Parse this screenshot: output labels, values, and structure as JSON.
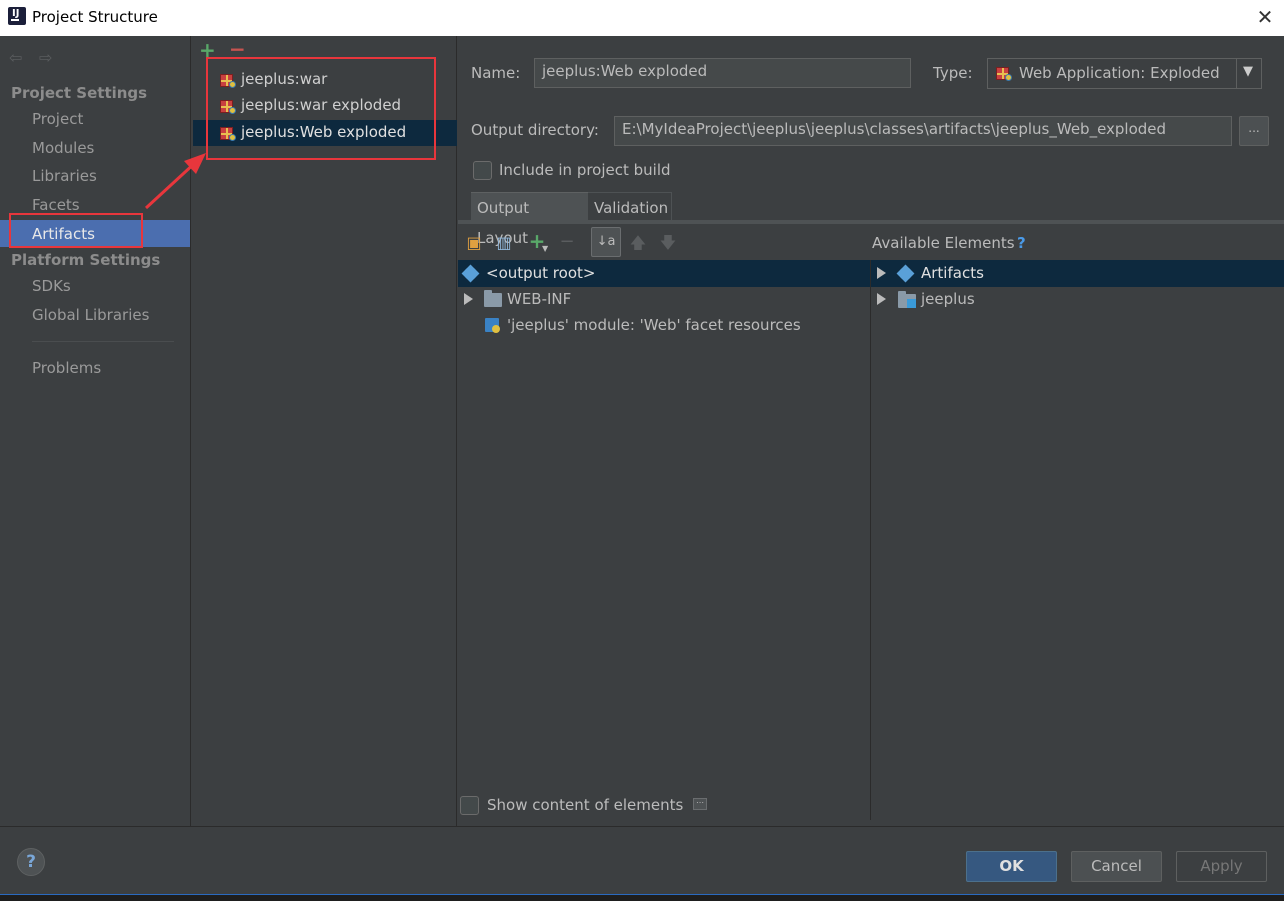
{
  "window": {
    "title": "Project Structure"
  },
  "sidebar": {
    "project_settings_header": "Project Settings",
    "project_items": [
      {
        "label": "Project"
      },
      {
        "label": "Modules"
      },
      {
        "label": "Libraries"
      },
      {
        "label": "Facets"
      },
      {
        "label": "Artifacts"
      }
    ],
    "platform_settings_header": "Platform Settings",
    "platform_items": [
      {
        "label": "SDKs"
      },
      {
        "label": "Global Libraries"
      }
    ],
    "problems_label": "Problems",
    "selected": "Artifacts"
  },
  "artifacts": {
    "add_symbol": "+",
    "remove_symbol": "−",
    "items": [
      {
        "label": "jeeplus:war"
      },
      {
        "label": "jeeplus:war exploded"
      },
      {
        "label": "jeeplus:Web exploded"
      }
    ],
    "selected": "jeeplus:Web exploded"
  },
  "details": {
    "name_label": "Name:",
    "name_value": "jeeplus:Web exploded",
    "type_label": "Type:",
    "type_value": "Web Application: Exploded",
    "output_dir_label": "Output directory:",
    "output_dir_value": "E:\\MyIdeaProject\\jeeplus\\jeeplus\\classes\\artifacts\\jeeplus_Web_exploded",
    "browse_label": "...",
    "include_in_build_label": "Include in project build",
    "include_in_build_checked": false,
    "tabs": [
      {
        "label": "Output Layout"
      },
      {
        "label": "Validation"
      }
    ],
    "active_tab": "Output Layout",
    "available_elements_label": "Available Elements",
    "help_mark": "?",
    "layout_tree": [
      {
        "label": "<output root>"
      },
      {
        "label": "WEB-INF"
      },
      {
        "label": "'jeeplus' module: 'Web' facet resources"
      }
    ],
    "available_tree": [
      {
        "label": "Artifacts"
      },
      {
        "label": "jeeplus"
      }
    ],
    "show_content_label": "Show content of elements",
    "show_content_checked": false
  },
  "footer": {
    "help_symbol": "?",
    "ok_label": "OK",
    "cancel_label": "Cancel",
    "apply_label": "Apply"
  },
  "colors": {
    "background": "#3c3f41",
    "selection_sidebar": "#4b6eaf",
    "selection_tree": "#0d293e",
    "annotation_red": "#e8363c",
    "add_green": "#59a869",
    "remove_red": "#c75450"
  }
}
